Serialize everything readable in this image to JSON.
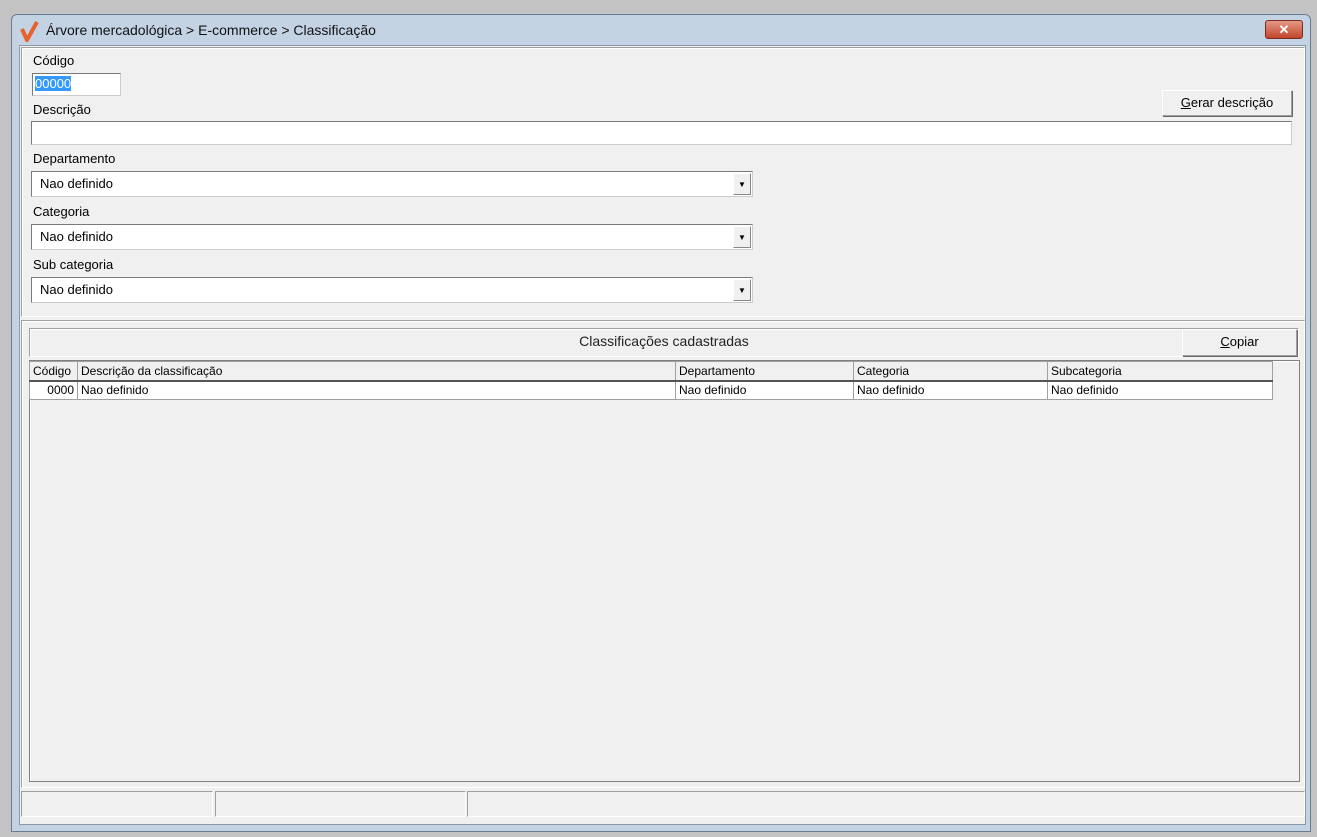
{
  "window": {
    "title": "Árvore mercadológica > E-commerce > Classificação",
    "close": "✕"
  },
  "form": {
    "codigo_label": "Código",
    "codigo_value": "00000",
    "descricao_label": "Descrição",
    "descricao_value": "",
    "gerar_button": {
      "accel": "G",
      "rest": "erar descrição"
    },
    "departamento_label": "Departamento",
    "departamento_value": "Nao definido",
    "categoria_label": "Categoria",
    "categoria_value": "Nao definido",
    "subcategoria_label": "Sub categoria",
    "subcategoria_value": "Nao definido"
  },
  "grid": {
    "title": "Classificações cadastradas",
    "copiar_button": {
      "accel": "C",
      "rest": "opiar"
    },
    "columns": [
      "Código",
      "Descrição da classificação",
      "Departamento",
      "Categoria",
      "Subcategoria"
    ],
    "rows": [
      [
        "0000",
        "Nao definido",
        "Nao definido",
        "Nao definido",
        "Nao definido"
      ]
    ]
  },
  "colors": {
    "accent": "#e8622c",
    "selection": "#3399ff"
  }
}
